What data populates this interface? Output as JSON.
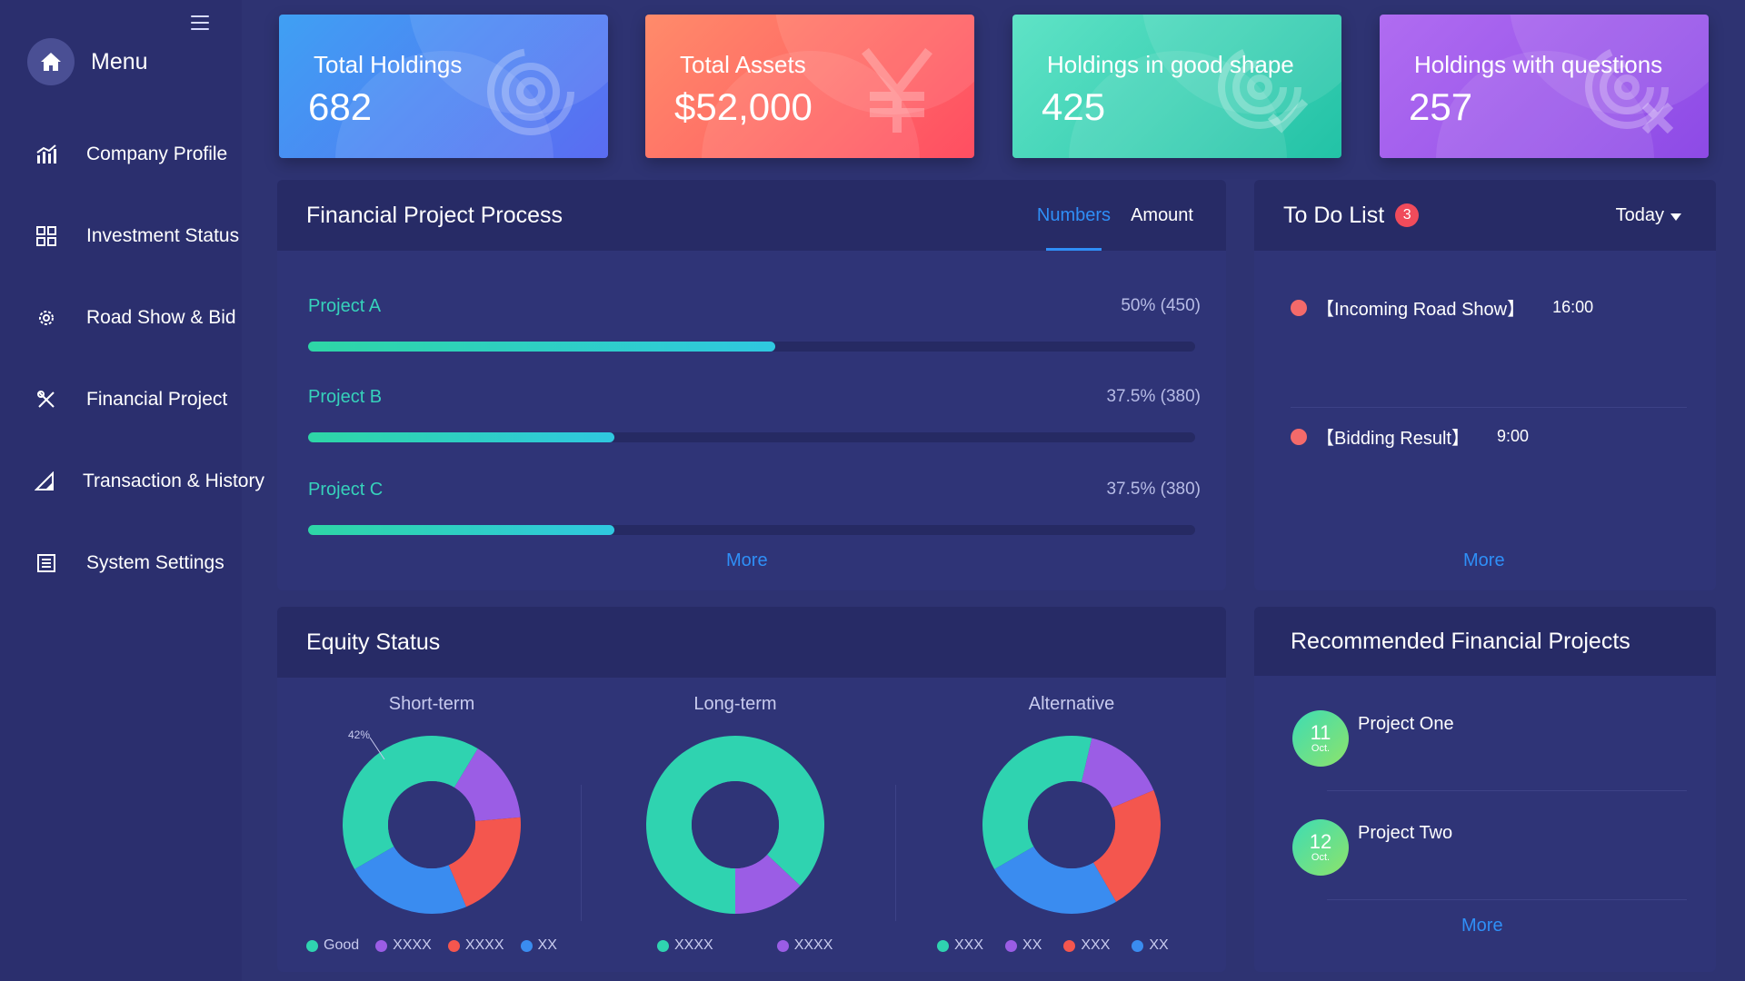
{
  "sidebar": {
    "menu_title": "Menu",
    "items": [
      {
        "label": "Company Profile",
        "icon": "bar-chart-icon"
      },
      {
        "label": "Investment Status",
        "icon": "grid-icon"
      },
      {
        "label": "Road Show & Bid",
        "icon": "gear-icon"
      },
      {
        "label": "Financial Project",
        "icon": "tools-icon"
      },
      {
        "label": "Transaction & History",
        "icon": "ruler-triangle-icon"
      },
      {
        "label": "System Settings",
        "icon": "list-icon"
      }
    ]
  },
  "stats": [
    {
      "label": "Total Holdings",
      "value": "682",
      "icon": "signal-icon"
    },
    {
      "label": "Total Assets",
      "value": "$52,000",
      "icon": "yen-icon"
    },
    {
      "label": "Holdings in good shape",
      "value": "425",
      "icon": "signal-check-icon"
    },
    {
      "label": "Holdings with questions",
      "value": "257",
      "icon": "signal-x-icon"
    }
  ],
  "financial": {
    "title": "Financial Project Process",
    "tabs": [
      "Numbers",
      "Amount"
    ],
    "active_tab": "Numbers",
    "projects": [
      {
        "name": "Project A",
        "value": "50% (450)",
        "progress": 0.527
      },
      {
        "name": "Project B",
        "value": "37.5% (380)",
        "progress": 0.345
      },
      {
        "name": "Project C",
        "value": "37.5% (380)",
        "progress": 0.345
      }
    ],
    "more": "More"
  },
  "todo": {
    "title": "To Do List",
    "badge": "3",
    "filter": "Today",
    "items": [
      {
        "label": "【Incoming Road Show】",
        "time": "16:00"
      },
      {
        "label": "【Bidding Result】",
        "time": "9:00"
      }
    ],
    "more": "More"
  },
  "equity": {
    "title": "Equity Status",
    "charts": [
      {
        "title": "Short-term",
        "annotation": "42%",
        "legend": [
          {
            "label": "Good",
            "color": "#2fd3b0"
          },
          {
            "label": "XXXX",
            "color": "#9b5de5"
          },
          {
            "label": "XXXX",
            "color": "#f4564e"
          },
          {
            "label": "XX",
            "color": "#3a8cf0"
          }
        ]
      },
      {
        "title": "Long-term",
        "legend": [
          {
            "label": "XXXX",
            "color": "#2fd3b0"
          },
          {
            "label": "XXXX",
            "color": "#9b5de5"
          }
        ]
      },
      {
        "title": "Alternative",
        "legend": [
          {
            "label": "XXX",
            "color": "#2fd3b0"
          },
          {
            "label": "XX",
            "color": "#9b5de5"
          },
          {
            "label": "XXX",
            "color": "#f4564e"
          },
          {
            "label": "XX",
            "color": "#3a8cf0"
          }
        ]
      }
    ]
  },
  "chart_data": [
    {
      "type": "pie",
      "title": "Short-term",
      "labels": [
        "Good",
        "XXXX",
        "XXXX",
        "XX"
      ],
      "values": [
        42,
        15,
        20,
        23
      ]
    },
    {
      "type": "pie",
      "title": "Long-term",
      "labels": [
        "XXXX",
        "XXXX"
      ],
      "values": [
        87,
        13
      ]
    },
    {
      "type": "pie",
      "title": "Alternative",
      "labels": [
        "XXX",
        "XX",
        "XXX",
        "XX"
      ],
      "values": [
        37,
        15,
        23,
        25
      ]
    }
  ],
  "recommended": {
    "title": "Recommended Financial Projects",
    "items": [
      {
        "day": "11",
        "month": "Oct.",
        "name": "Project One"
      },
      {
        "day": "12",
        "month": "Oct.",
        "name": "Project Two"
      }
    ],
    "more": "More"
  },
  "colors": {
    "background": "#2e3372",
    "accent_blue": "#2f8ff7",
    "teal": "#36d2bb",
    "red": "#f4564e",
    "purple": "#9b5de5",
    "blue": "#3a8cf0"
  }
}
